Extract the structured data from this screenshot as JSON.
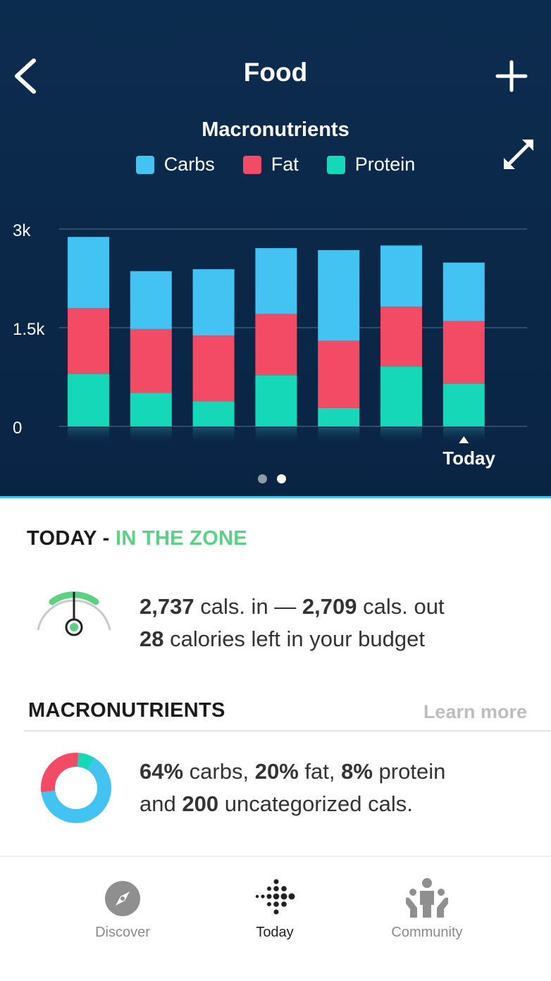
{
  "header": {
    "title": "Food",
    "back_icon": "chevron-left-icon",
    "add_icon": "plus-icon",
    "expand_icon": "expand-icon"
  },
  "chart_data": {
    "type": "bar",
    "stacked": true,
    "title": "Macronutrients",
    "categories": [
      "",
      "",
      "",
      "",
      "",
      "",
      "Today"
    ],
    "series": [
      {
        "name": "Protein",
        "color": "#14d8b8",
        "values": [
          800,
          510,
          380,
          780,
          280,
          910,
          650
        ]
      },
      {
        "name": "Fat",
        "color": "#f34b66",
        "values": [
          1000,
          970,
          1000,
          930,
          1020,
          910,
          950
        ]
      },
      {
        "name": "Carbs",
        "color": "#43c3f2",
        "values": [
          1080,
          880,
          1010,
          1000,
          1380,
          930,
          890
        ]
      }
    ],
    "y_ticks": [
      "3k",
      "1.5k",
      "0"
    ],
    "ylim": [
      0,
      3000
    ],
    "grid": true,
    "today_label": "Today",
    "page_count": 2,
    "active_page": 2
  },
  "legend": [
    {
      "label": "Carbs",
      "color": "#43c3f2"
    },
    {
      "label": "Fat",
      "color": "#f34b66"
    },
    {
      "label": "Protein",
      "color": "#14d8b8"
    }
  ],
  "today": {
    "heading_prefix": "TODAY - ",
    "heading_status": "IN THE ZONE",
    "status_color": "#5bd184",
    "cals_in": "2,737",
    "cals_in_label": "cals. in — ",
    "cals_out": "2,709",
    "cals_out_label": "cals. out",
    "calories_left": "28",
    "calories_left_label": "calories left in your budget"
  },
  "macros": {
    "heading": "MACRONUTRIENTS",
    "learn_more": "Learn more",
    "carbs_pct": "64%",
    "carbs_label": "carbs,",
    "fat_pct": "20%",
    "fat_label": "fat,",
    "protein_pct": "8%",
    "protein_label": "protein",
    "and_label": "and",
    "uncategorized": "200",
    "uncategorized_label": "uncategorized cals.",
    "donut": [
      {
        "name": "carbs",
        "value": 64,
        "color": "#43c3f2"
      },
      {
        "name": "fat",
        "value": 28,
        "color": "#f34b66"
      },
      {
        "name": "protein",
        "value": 8,
        "color": "#14d8b8"
      }
    ]
  },
  "nav": {
    "items": [
      {
        "label": "Discover",
        "icon": "compass-icon",
        "active": false
      },
      {
        "label": "Today",
        "icon": "fitbit-dots-icon",
        "active": true
      },
      {
        "label": "Community",
        "icon": "community-icon",
        "active": false
      }
    ]
  }
}
